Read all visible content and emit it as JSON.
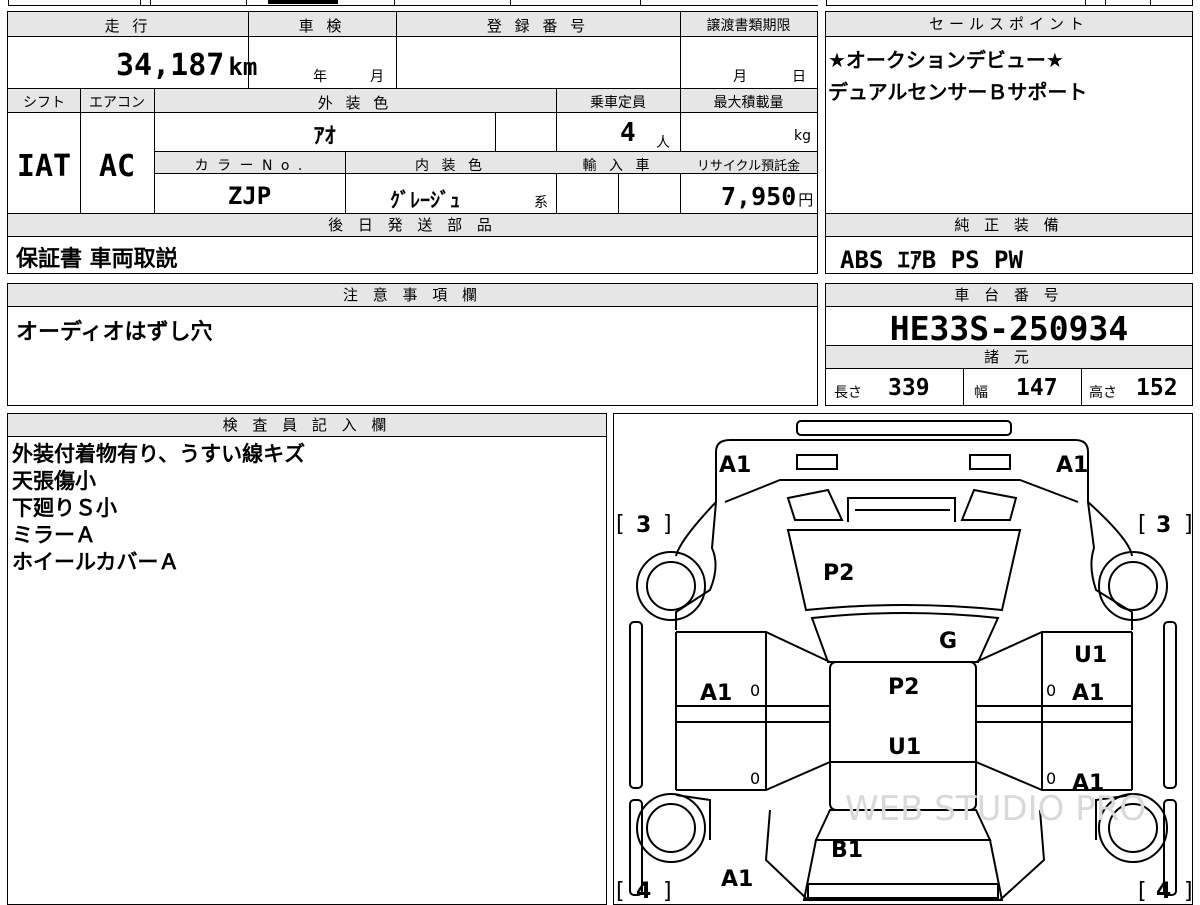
{
  "mileage": {
    "label": "走 行",
    "value": "34,187",
    "unit": "km"
  },
  "shaken": {
    "label": "車 検",
    "year_unit": "年",
    "month_unit": "月"
  },
  "registration": {
    "label": "登 録 番 号"
  },
  "transfer_deadline": {
    "label": "譲渡書類期限",
    "month_unit": "月",
    "day_unit": "日"
  },
  "shift": {
    "label": "シフト",
    "value": "IAT"
  },
  "aircon": {
    "label": "エアコン",
    "value": "AC"
  },
  "exterior_color": {
    "label": "外 装 色",
    "value": "ｱｵ"
  },
  "capacity": {
    "label": "乗車定員",
    "value": "4",
    "unit": "人"
  },
  "max_load": {
    "label": "最大積載量",
    "unit": "kg"
  },
  "color_no": {
    "label": "カ ラ ー N o .",
    "value": "ZJP"
  },
  "interior_color": {
    "label": "内 装 色",
    "value": "ｸﾞﾚｰｼﾞｭ",
    "suffix": "系"
  },
  "import": {
    "label": "輸 入 車"
  },
  "recycle": {
    "label": "リサイクル預託金",
    "value": "7,950",
    "unit": "円"
  },
  "later_parts": {
    "label": "後 日 発 送 部 品",
    "value": "保証書 車両取説"
  },
  "sales_point": {
    "label": "セールスポイント",
    "lines": [
      "★オークションデビュー★",
      "デュアルセンサーＢサポート"
    ]
  },
  "equipment": {
    "label": "純 正 装 備",
    "value": "ABS ｴｱB PS PW"
  },
  "notes": {
    "label": "注 意 事 項 欄",
    "value": "オーディオはずし穴"
  },
  "chassis": {
    "label": "車 台 番 号",
    "value": "HE33S-250934"
  },
  "specs": {
    "label": "諸 元",
    "length_label": "長さ",
    "length": "339",
    "width_label": "幅",
    "width": "147",
    "height_label": "高さ",
    "height": "152"
  },
  "inspector": {
    "label": "検 査 員 記 入 欄",
    "lines": [
      "外装付着物有り、うすい線キズ",
      "天張傷小",
      "下廻りＳ小",
      "ミラーＡ",
      "ホイールカバーＡ"
    ]
  },
  "diagram": {
    "marks": {
      "front_left": "A1",
      "front_right": "A1",
      "tire_fl": "3",
      "tire_fr": "3",
      "tire_rl": "4",
      "tire_rr": "4",
      "hood": "P2",
      "windshield": "G",
      "roof": "P2",
      "roof_lower": "U1",
      "right_front_upper": "U1",
      "left_front_door": "A1",
      "right_front_door": "A1",
      "right_rear_door": "A1",
      "back_door": "B1",
      "rear_left": "A1",
      "small_zero": "0"
    },
    "watermark": "WEB STUDIO PRO"
  }
}
